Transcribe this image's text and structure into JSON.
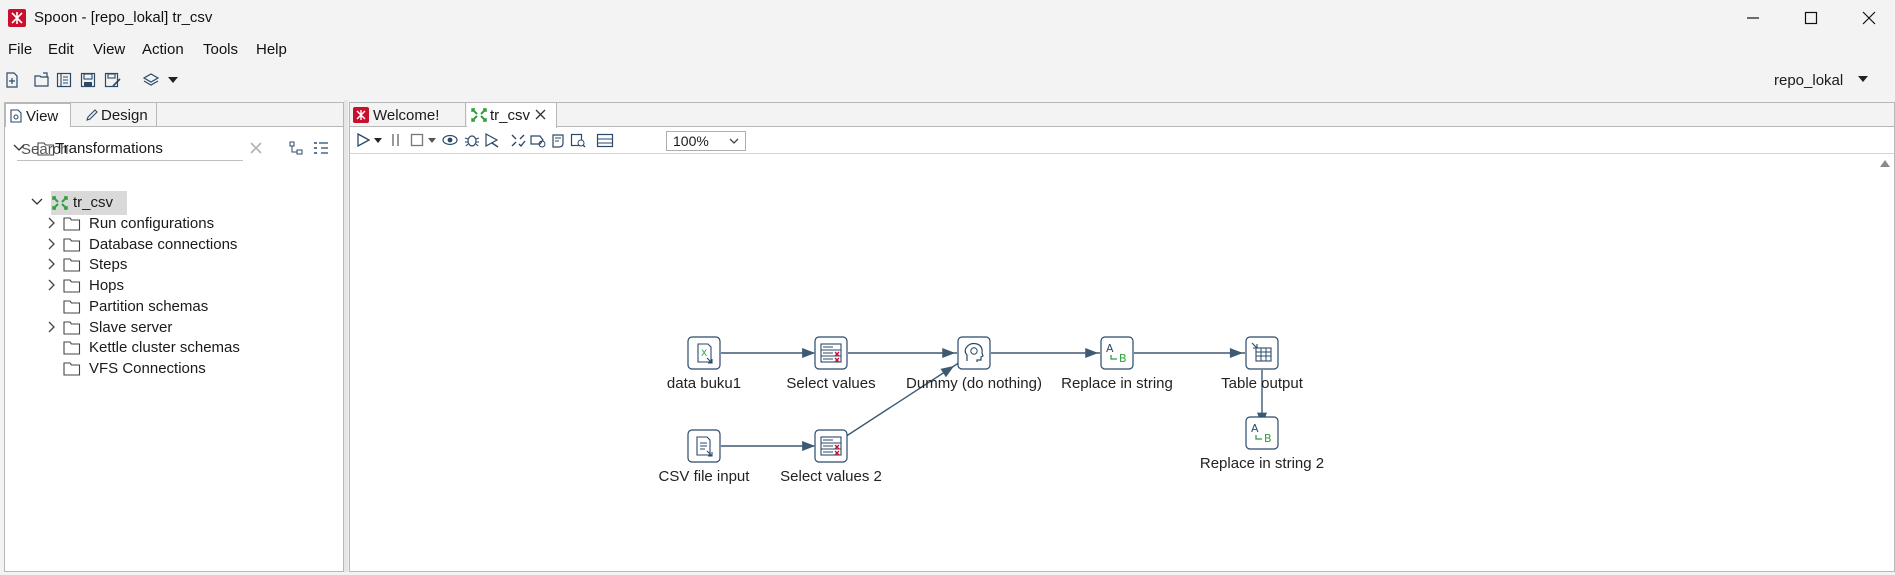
{
  "window": {
    "title": "Spoon - [repo_lokal] tr_csv",
    "minimize_icon": "minimize-icon",
    "maximize_icon": "maximize-icon",
    "close_icon": "close-icon"
  },
  "menu": [
    "File",
    "Edit",
    "View",
    "Action",
    "Tools",
    "Help"
  ],
  "toolbar": {
    "icons": [
      "new-file-icon",
      "open-file-icon",
      "explore-repository-icon",
      "save-icon",
      "save-as-icon",
      "layers-icon",
      "dropdown-caret-icon"
    ],
    "repository": "repo_lokal"
  },
  "left_panel": {
    "tabs": [
      {
        "label": "View",
        "icon": "view-icon"
      },
      {
        "label": "Design",
        "icon": "pencil-icon"
      }
    ],
    "search_placeholder": "Search",
    "tree": {
      "root": "Transformations",
      "transformation": "tr_csv",
      "children": [
        {
          "label": "Run configurations",
          "expandable": true
        },
        {
          "label": "Database connections",
          "expandable": true
        },
        {
          "label": "Steps",
          "expandable": true
        },
        {
          "label": "Hops",
          "expandable": true
        },
        {
          "label": "Partition schemas",
          "expandable": false
        },
        {
          "label": "Slave server",
          "expandable": true
        },
        {
          "label": "Kettle cluster schemas",
          "expandable": false
        },
        {
          "label": "VFS Connections",
          "expandable": false
        }
      ]
    }
  },
  "editor": {
    "tabs": [
      {
        "label": "Welcome!",
        "icon": "spoon-logo-icon"
      },
      {
        "label": "tr_csv",
        "icon": "transformation-icon",
        "closable": true
      }
    ],
    "toolbar_icons": [
      "run-icon",
      "run-options-icon",
      "pause-icon",
      "stop-icon",
      "stop-options-icon",
      "preview-icon",
      "debug-icon",
      "replay-icon",
      "verify-icon",
      "analyze-impact-icon",
      "sql-icon",
      "explore-db-icon",
      "show-results-icon"
    ],
    "zoom": "100%"
  },
  "transformation": {
    "steps": [
      {
        "id": "data_buku1",
        "label": "data buku1",
        "icon": "excel-input-icon"
      },
      {
        "id": "select_values",
        "label": "Select values",
        "icon": "select-values-icon"
      },
      {
        "id": "dummy",
        "label": "Dummy (do nothing)",
        "icon": "dummy-icon"
      },
      {
        "id": "replace_in_string",
        "label": "Replace in string",
        "icon": "replace-string-icon"
      },
      {
        "id": "table_output",
        "label": "Table output",
        "icon": "table-output-icon"
      },
      {
        "id": "csv_input",
        "label": "CSV file input",
        "icon": "csv-input-icon"
      },
      {
        "id": "select_values_2",
        "label": "Select values 2",
        "icon": "select-values-icon"
      },
      {
        "id": "replace_in_string_2",
        "label": "Replace in string 2",
        "icon": "replace-string-icon"
      }
    ],
    "hops": [
      [
        "data_buku1",
        "select_values"
      ],
      [
        "select_values",
        "dummy"
      ],
      [
        "dummy",
        "replace_in_string"
      ],
      [
        "replace_in_string",
        "table_output"
      ],
      [
        "table_output",
        "replace_in_string_2"
      ],
      [
        "csv_input",
        "select_values_2"
      ],
      [
        "select_values_2",
        "dummy"
      ]
    ]
  },
  "colors": {
    "brand_red": "#c8102e",
    "step_green": "#2e9e3a",
    "hop_color": "#3d5a72"
  }
}
